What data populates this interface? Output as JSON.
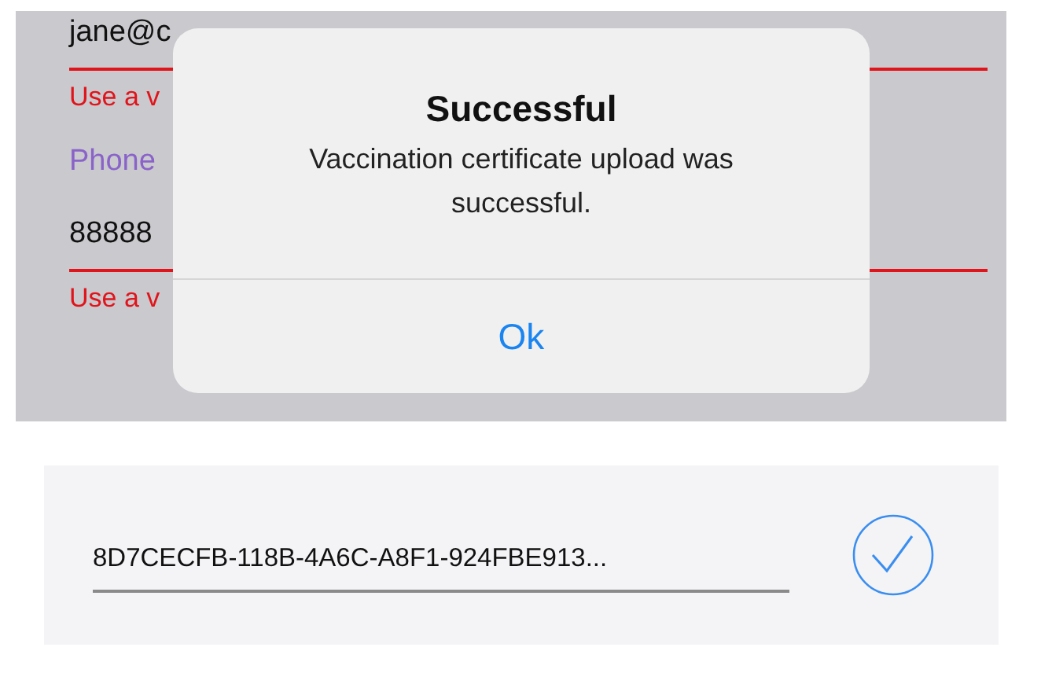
{
  "form": {
    "fields": [
      {
        "kind": "input",
        "value": "jane@c",
        "invalid": true
      },
      {
        "kind": "error",
        "text": "Use a v"
      },
      {
        "kind": "label",
        "text": "Phone"
      },
      {
        "kind": "input",
        "value": "88888",
        "invalid": true
      },
      {
        "kind": "error",
        "text": "Use a v"
      }
    ]
  },
  "alert": {
    "title": "Successful",
    "message": "Vaccination certificate upload was successful.",
    "button": "Ok"
  },
  "certificate": {
    "value": "8D7CECFB-118B-4A6C-A8F1-924FBE913...",
    "verified": true
  }
}
